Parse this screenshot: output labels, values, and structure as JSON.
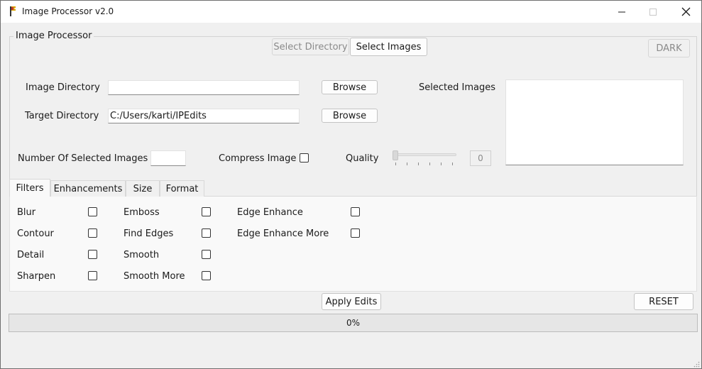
{
  "window": {
    "title": "Image Processor v2.0",
    "minimize": "—",
    "maximize": "☐",
    "close": "✕"
  },
  "group": {
    "title": "Image Processor"
  },
  "mode": {
    "select_directory": "Select Directory",
    "select_images": "Select Images"
  },
  "theme": {
    "label": "DARK"
  },
  "image_directory": {
    "label": "Image Directory",
    "value": "",
    "browse": "Browse"
  },
  "target_directory": {
    "label": "Target Directory",
    "value": "C:/Users/karti/IPEdits",
    "browse": "Browse"
  },
  "selected_images": {
    "label": "Selected Images",
    "items": []
  },
  "count": {
    "label": "Number Of Selected Images",
    "value": ""
  },
  "compress": {
    "label": "Compress Image",
    "checked": false
  },
  "quality": {
    "label": "Quality",
    "value": "0"
  },
  "tabs": [
    {
      "label": "Filters"
    },
    {
      "label": "Enhancements"
    },
    {
      "label": "Size"
    },
    {
      "label": "Format"
    }
  ],
  "filters": {
    "blur": "Blur",
    "contour": "Contour",
    "detail": "Detail",
    "sharpen": "Sharpen",
    "emboss": "Emboss",
    "find_edges": "Find Edges",
    "smooth": "Smooth",
    "smooth_more": "Smooth More",
    "edge_enhance": "Edge Enhance",
    "edge_enhance_more": "Edge Enhance More"
  },
  "actions": {
    "apply": "Apply Edits",
    "reset": "RESET"
  },
  "progress": {
    "percent": 0,
    "label": "0%"
  },
  "icons": {
    "app": "flag-icon",
    "minimize": "minimize-icon",
    "maximize": "maximize-icon",
    "close": "close-icon",
    "resize": "resize-grip-icon"
  }
}
